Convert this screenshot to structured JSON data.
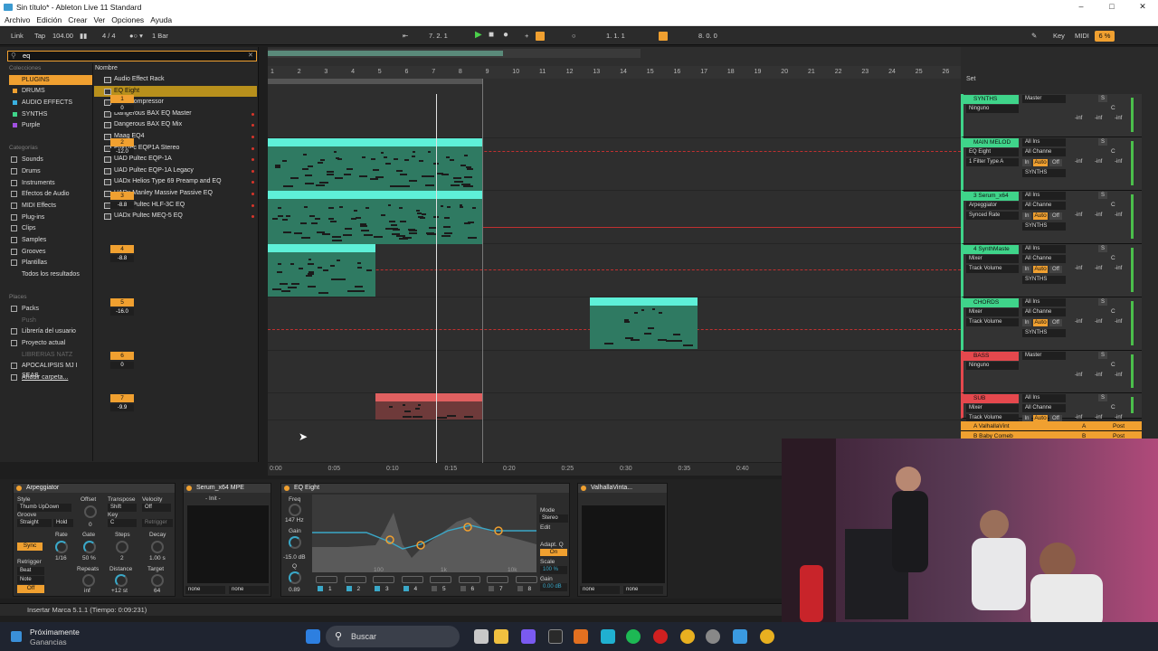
{
  "window": {
    "title": "Sin título* - Ableton Live 11 Standard"
  },
  "menu": [
    "Archivo",
    "Edición",
    "Crear",
    "Ver",
    "Opciones",
    "Ayuda"
  ],
  "transport": {
    "link": "Link",
    "tap": "Tap",
    "tempo": "104.00",
    "signature": "4 / 4",
    "quantize": "1 Bar",
    "position": "7.  2.  1",
    "loop_start": "1.  1.  1",
    "loop_length": "8.  0.  0",
    "key": "Key",
    "midi": "MIDI",
    "cpu": "6 %"
  },
  "browser": {
    "search_value": "eq",
    "collections_header": "Colecciones",
    "collections": [
      "PLUGINS",
      "DRUMS",
      "AUDIO EFFECTS",
      "SYNTHS",
      "Purple"
    ],
    "categories_header": "Categorías",
    "categories": [
      "Sounds",
      "Drums",
      "Instruments",
      "Efectos de Audio",
      "MIDI Effects",
      "Plug-ins",
      "Clips",
      "Samples",
      "Grooves",
      "Plantillas",
      "Todos los resultados"
    ],
    "places_header": "Places",
    "places": [
      "Packs",
      "Push",
      "Librería del usuario",
      "Proyecto actual",
      "LIBRERIAS NATZ",
      "APOCALIPSIS MJ I SEAS",
      "Añadir carpeta..."
    ],
    "name_header": "Nombre",
    "items": [
      "Audio Effect Rack",
      "EQ Eight",
      "Glue Compressor",
      "Dangerous BAX EQ Master",
      "Dangerous BAX EQ Mix",
      "Maag EQ4",
      "PuigTec EQP1A Stereo",
      "UAD Pultec EQP-1A",
      "UAD Pultec EQP-1A Legacy",
      "UADx Helios Type 69 Preamp and EQ",
      "UADx Manley Massive Passive EQ",
      "UADx Pultec HLF-3C EQ",
      "UADx Pultec MEQ-5 EQ"
    ]
  },
  "ruler": [
    "1",
    "2",
    "3",
    "4",
    "5",
    "6",
    "7",
    "8",
    "9",
    "10",
    "11",
    "12",
    "13",
    "14",
    "15",
    "16",
    "17",
    "18",
    "19",
    "20",
    "21",
    "22",
    "23",
    "24",
    "25",
    "26"
  ],
  "time_axis": [
    "0:00",
    "0:05",
    "0:10",
    "0:15",
    "0:20",
    "0:25",
    "0:30",
    "0:35",
    "0:40"
  ],
  "mixer": {
    "set_label": "Set",
    "tracks": [
      {
        "name": "SYNTHS",
        "color": "#3fd48a",
        "io1": "Master",
        "io2": "Ninguno",
        "num": "1",
        "vol": "0",
        "pan": "C",
        "inf": "-inf"
      },
      {
        "name": "MAIN MELOD",
        "color": "#3fd48a",
        "io1": "All Ins",
        "io2": "All Channe",
        "dev1": "EQ Eight",
        "dev2": "1 Filter Type A",
        "out": "SYNTHS",
        "num": "2",
        "vol": "-12.0",
        "pan": "C",
        "inf": "-inf",
        "auto": "Auto",
        "off": "Off",
        "in": "In"
      },
      {
        "name": "3 Serum_x64",
        "color": "#3fd48a",
        "io1": "All Ins",
        "io2": "All Channe",
        "dev1": "Arpeggiator",
        "dev2": "Synced Rate",
        "out": "SYNTHS",
        "num": "3",
        "vol": "-8.8",
        "pan": "C",
        "inf": "-inf",
        "auto": "Auto",
        "off": "Off",
        "in": "In"
      },
      {
        "name": "4 SynthMaste",
        "color": "#3fd48a",
        "io1": "All Ins",
        "io2": "All Channe",
        "dev1": "Mixer",
        "dev2": "Track Volume",
        "out": "SYNTHS",
        "num": "4",
        "vol": "-8.8",
        "pan": "C",
        "inf": "-inf",
        "auto": "Auto",
        "off": "Off",
        "in": "In"
      },
      {
        "name": "CHORDS",
        "color": "#3fd48a",
        "io1": "All Ins",
        "io2": "All Channe",
        "dev1": "Mixer",
        "dev2": "Track Volume",
        "out": "SYNTHS",
        "num": "5",
        "vol": "-16.0",
        "pan": "C",
        "inf": "-inf",
        "auto": "Auto",
        "off": "Off",
        "in": "In"
      },
      {
        "name": "BASS",
        "color": "#e5484d",
        "io1": "Master",
        "io2": "Ninguno",
        "num": "6",
        "vol": "0",
        "pan": "C",
        "inf": "-inf"
      },
      {
        "name": "SUB",
        "color": "#e5484d",
        "io1": "All Ins",
        "io2": "All Channe",
        "dev1": "Mixer",
        "dev2": "Track Volume",
        "num": "7",
        "vol": "-9.9",
        "pan": "C",
        "inf": "-inf",
        "auto": "Auto",
        "off": "Off",
        "in": "In"
      }
    ],
    "returns": [
      {
        "name": "A ValhallaVint",
        "letter": "A",
        "post": "Post"
      },
      {
        "name": "B Baby Comeb",
        "letter": "B",
        "post": "Post"
      }
    ]
  },
  "devices": {
    "arpeggiator": {
      "title": "Arpeggiator",
      "style_label": "Style",
      "style": "Thumb UpDown",
      "groove_label": "Groove",
      "groove": "Straight",
      "hold": "Hold",
      "offset_label": "Offset",
      "offset": "0",
      "transpose_label": "Transpose",
      "transpose": "Shift",
      "key_label": "Key",
      "key": "C",
      "velocity_label": "Velocity",
      "velocity": "Off",
      "retrigger_btn": "Retrigger",
      "sync": "Sync",
      "rate_label": "Rate",
      "rate": "1/16",
      "gate_label": "Gate",
      "gate": "50 %",
      "steps_label": "Steps",
      "steps": "2",
      "decay_label": "Decay",
      "decay": "1.00 s",
      "retrigger_label": "Retrigger",
      "beat": "Beat",
      "note": "Note",
      "off": "Off",
      "repeats_label": "Repeats",
      "repeats": "inf",
      "distance_label": "Distance",
      "distance": "+12 st",
      "target_label": "Target",
      "target": "64"
    },
    "serum": {
      "title": "Serum_x64 MPE",
      "preset": "- Init -",
      "none1": "none",
      "none2": "none"
    },
    "eq": {
      "title": "EQ Eight",
      "freq_label": "Freq",
      "freq": "147 Hz",
      "gain_label": "Gain",
      "gain": "-15.0 dB",
      "q_label": "Q",
      "q": "0.89",
      "mode_label": "Mode",
      "mode": "Stereo",
      "edit_label": "Edit",
      "adapt_label": "Adapt. Q",
      "adapt": "On",
      "scale_label": "Scale",
      "scale": "100 %",
      "gain2_label": "Gain",
      "gain2": "0.00 dB",
      "freq_ticks": [
        "100",
        "1k",
        "10k"
      ],
      "bands": [
        "1",
        "2",
        "3",
        "4",
        "5",
        "6",
        "7",
        "8"
      ]
    },
    "valhalla": {
      "title": "ValhallaVinta...",
      "none1": "none",
      "none2": "none"
    }
  },
  "status": "Insertar Marca 5.1.1 (Tiempo: 0:09:231)",
  "taskbar": {
    "weather_title": "Próximamente",
    "weather_sub": "Ganancias",
    "search": "Buscar"
  },
  "colors": {
    "accent": "#f0a030",
    "clip_green": "#2f7a62",
    "clip_head": "#5ef0d8",
    "bass_red": "#e06060"
  }
}
